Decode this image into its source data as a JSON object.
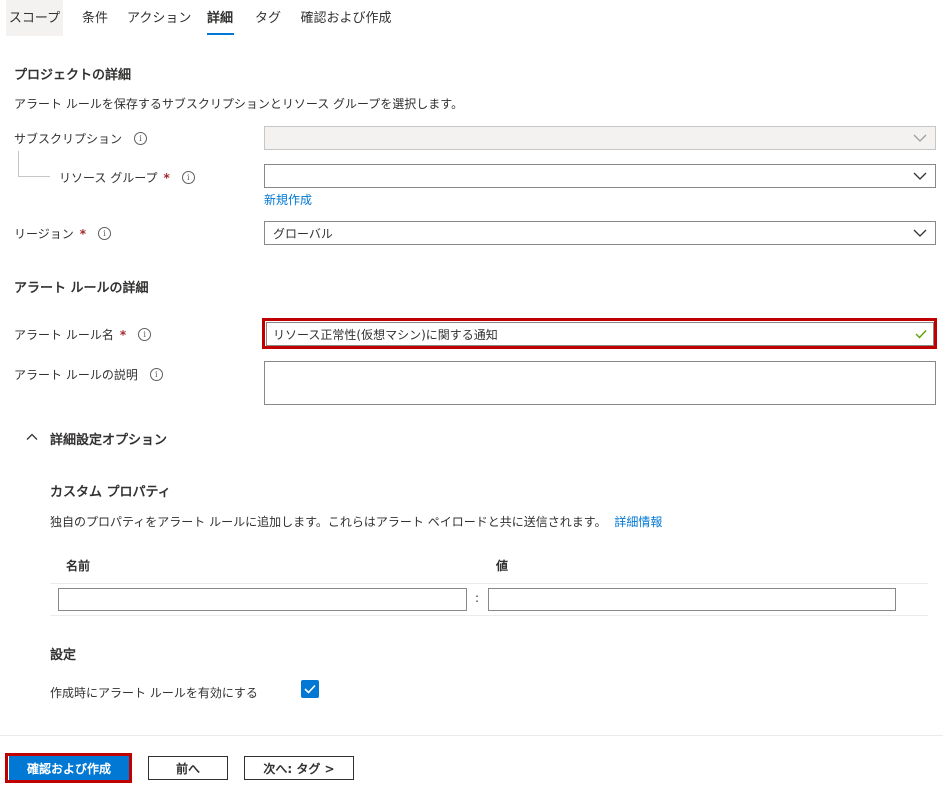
{
  "tabs": [
    {
      "label": "スコープ"
    },
    {
      "label": "条件"
    },
    {
      "label": "アクション"
    },
    {
      "label": "詳細"
    },
    {
      "label": "タグ"
    },
    {
      "label": "確認および作成"
    }
  ],
  "project": {
    "title": "プロジェクトの詳細",
    "description": "アラート ルールを保存するサブスクリプションとリソース グループを選択します。",
    "subscription_label": "サブスクリプション",
    "subscription_value": "",
    "resource_group_label": "リソース グループ",
    "resource_group_value": "",
    "create_new_link": "新規作成",
    "region_label": "リージョン",
    "region_value": "グローバル"
  },
  "rule": {
    "title": "アラート ルールの詳細",
    "name_label": "アラート ルール名",
    "name_value": "リソース正常性(仮想マシン)に関する通知",
    "description_label": "アラート ルールの説明",
    "description_value": ""
  },
  "advanced": {
    "title": "詳細設定オプション",
    "custom_props_title": "カスタム プロパティ",
    "custom_props_description": "独自のプロパティをアラート ルールに追加します。これらはアラート ペイロードと共に送信されます。",
    "learn_more_link": "詳細情報",
    "col_name": "名前",
    "col_value": "値",
    "separator": ":",
    "settings_title": "設定",
    "enable_on_create_label": "作成時にアラート ルールを有効にする",
    "enable_on_create_checked": true
  },
  "footer": {
    "review_create": "確認および作成",
    "previous": "前へ",
    "next": "次へ: タグ >"
  },
  "colors": {
    "accent": "#0078d4",
    "required": "#a4262c",
    "highlight": "#c00000"
  }
}
